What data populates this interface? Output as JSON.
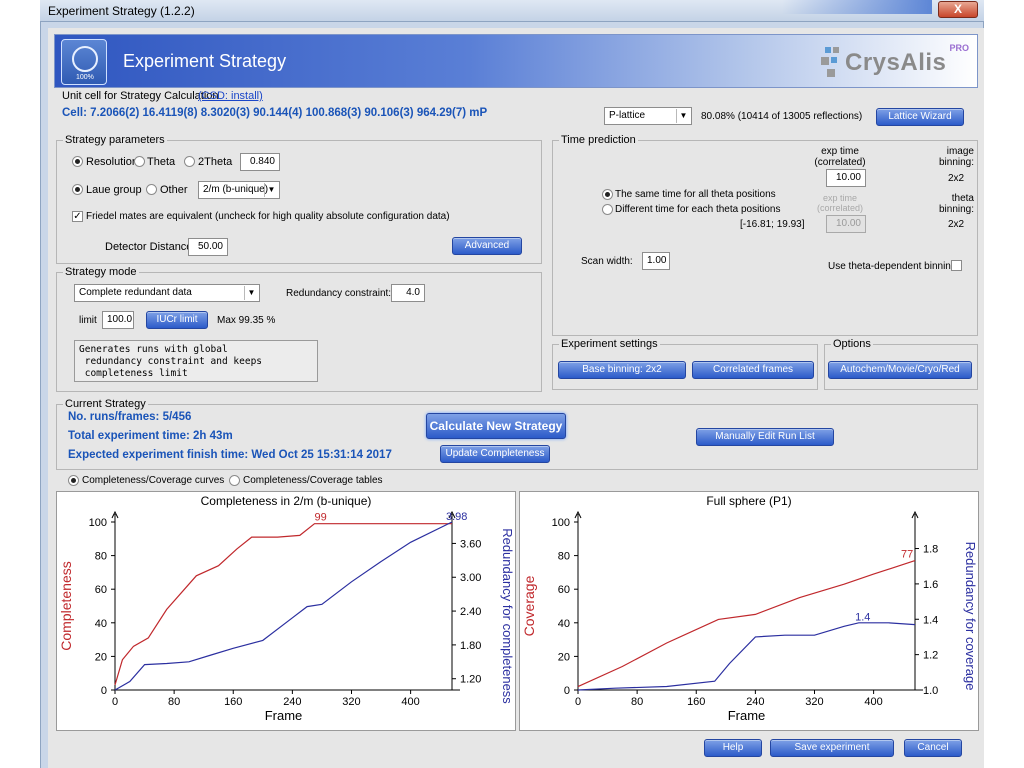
{
  "window": {
    "title": "Experiment Strategy  (1.2.2)",
    "close": "X"
  },
  "header": {
    "title": "Experiment Strategy",
    "logo_pct": "100%",
    "brand": "CrysAlis",
    "brand_sup": "PRO"
  },
  "unit_cell": {
    "label": "Unit cell for Strategy Calculation",
    "csd_link": "(CSD: install)",
    "cell": "Cell: 7.2066(2) 16.4119(8) 8.3020(3) 90.144(4) 100.868(3) 90.106(3) 964.29(7)  mP",
    "lattice": "P-lattice",
    "match": "80.08% (10414 of 13005 reflections)",
    "wizard_button": "Lattice Wizard"
  },
  "strategy_params": {
    "title": "Strategy parameters",
    "resolution": "Resolution",
    "theta": "Theta",
    "two_theta": "2Theta",
    "resolution_value": "0.840",
    "laue_group": "Laue group",
    "other": "Other",
    "laue_value": "2/m (b-unique)",
    "friedel": "Friedel mates are equivalent (uncheck for high quality absolute configuration data)",
    "detector_label": "Detector Distance",
    "detector_value": "50.00",
    "advanced_button": "Advanced"
  },
  "time_prediction": {
    "title": "Time prediction",
    "exp_time_header": "exp time\n(correlated)",
    "image_binning_header": "image\nbinning:",
    "exp_time_value": "10.00",
    "image_binning_value": "2x2",
    "same_time": "The same time for all theta positions",
    "different_time": "Different time for each theta positions",
    "exp_time_disabled_header": "exp time\n(correlated)",
    "theta_binning_header": "theta\nbinning:",
    "range": "[-16.81; 19.93]",
    "exp_time_disabled_value": "10.00",
    "theta_binning_value": "2x2",
    "scan_width_label": "Scan width:",
    "scan_width_value": "1.00",
    "theta_dependent": "Use theta-dependent binning"
  },
  "strategy_mode": {
    "title": "Strategy mode",
    "mode_value": "Complete redundant data",
    "redundancy_label": "Redundancy constraint:",
    "redundancy_value": "4.0",
    "limit_label": "limit",
    "limit_value": "100.0",
    "iucr_button": "IUCr limit",
    "max_label": "Max 99.35 %",
    "description": "Generates runs with global\n redundancy constraint and keeps\n completeness limit"
  },
  "experiment_settings": {
    "title": "Experiment settings",
    "base_binning_button": "Base binning: 2x2",
    "correlated_button": "Correlated frames"
  },
  "options": {
    "title": "Options",
    "autochem_button": "Autochem/Movie/Cryo/Red"
  },
  "current_strategy": {
    "title": "Current Strategy",
    "runs": "No. runs/frames: 5/456",
    "total_time": "Total experiment time: 2h 43m",
    "finish_time": "Expected experiment finish time: Wed Oct 25 15:31:14 2017",
    "calc_button": "Calculate New Strategy",
    "update_button": "Update Completeness",
    "manual_button": "Manually Edit Run List"
  },
  "view_toggle": {
    "curves": "Completeness/Coverage curves",
    "tables": "Completeness/Coverage tables"
  },
  "footer": {
    "help": "Help",
    "save": "Save experiment",
    "cancel": "Cancel"
  },
  "colors": {
    "red_series": "#c0282c",
    "blue_series": "#2b2fa0",
    "accent_blue": "#1a54b8"
  },
  "chart_data": [
    {
      "type": "line",
      "title": "Completeness in 2/m (b-unique)",
      "xlabel": "Frame",
      "ylabel": "Completeness",
      "y2label": "Redundancy for completeness",
      "xlim": [
        0,
        456
      ],
      "ylim": [
        0,
        100
      ],
      "y2lim": [
        1.0,
        3.98
      ],
      "xticks": [
        0,
        80,
        160,
        240,
        320,
        400
      ],
      "yticks": [
        0,
        20,
        40,
        60,
        80,
        100
      ],
      "y2ticks": [
        1.2,
        1.8,
        2.4,
        3.0,
        3.6
      ],
      "xtick_labels": [
        "0",
        "80",
        "160",
        "240",
        "320",
        "400"
      ],
      "ytick_labels": [
        "0",
        "20",
        "40",
        "60",
        "80",
        "100"
      ],
      "y2tick_labels": [
        "1.20",
        "1.80",
        "2.40",
        "3.00",
        "3.60"
      ],
      "end_labels": [
        "99",
        "3.98"
      ],
      "series": [
        {
          "axis": "left",
          "x": [
            0,
            10,
            25,
            45,
            70,
            110,
            140,
            165,
            185,
            200,
            220,
            250,
            270,
            300,
            340,
            380,
            456
          ],
          "y": [
            3,
            18,
            26,
            31,
            48,
            68,
            74,
            84,
            91,
            91,
            91,
            92,
            99,
            99,
            99,
            99,
            99
          ]
        },
        {
          "axis": "right",
          "x": [
            0,
            20,
            40,
            70,
            100,
            130,
            160,
            200,
            240,
            260,
            280,
            320,
            360,
            400,
            456
          ],
          "y": [
            1.0,
            1.15,
            1.45,
            1.47,
            1.5,
            1.62,
            1.74,
            1.88,
            2.28,
            2.48,
            2.52,
            2.92,
            3.28,
            3.62,
            3.98
          ]
        }
      ]
    },
    {
      "type": "line",
      "title": "Full sphere (P1)",
      "xlabel": "Frame",
      "ylabel": "Coverage",
      "y2label": "Redundancy for coverage",
      "xlim": [
        0,
        456
      ],
      "ylim": [
        0,
        100
      ],
      "y2lim": [
        1.0,
        1.95
      ],
      "xticks": [
        0,
        80,
        160,
        240,
        320,
        400
      ],
      "yticks": [
        0,
        20,
        40,
        60,
        80,
        100
      ],
      "y2ticks": [
        1.0,
        1.2,
        1.4,
        1.6,
        1.8
      ],
      "xtick_labels": [
        "0",
        "80",
        "160",
        "240",
        "320",
        "400"
      ],
      "ytick_labels": [
        "0",
        "20",
        "40",
        "60",
        "80",
        "100"
      ],
      "y2tick_labels": [
        "1.0",
        "1.2",
        "1.4",
        "1.6",
        "1.8"
      ],
      "end_labels": [
        "77",
        "1.4"
      ],
      "series": [
        {
          "axis": "left",
          "x": [
            0,
            60,
            120,
            190,
            240,
            300,
            360,
            400,
            456
          ],
          "y": [
            2,
            14,
            28,
            42,
            45,
            55,
            63,
            69,
            77
          ]
        },
        {
          "axis": "right",
          "x": [
            0,
            50,
            120,
            185,
            205,
            240,
            280,
            320,
            360,
            380,
            420,
            456
          ],
          "y": [
            1.0,
            1.01,
            1.02,
            1.05,
            1.15,
            1.3,
            1.31,
            1.31,
            1.36,
            1.38,
            1.38,
            1.37
          ]
        }
      ]
    }
  ]
}
